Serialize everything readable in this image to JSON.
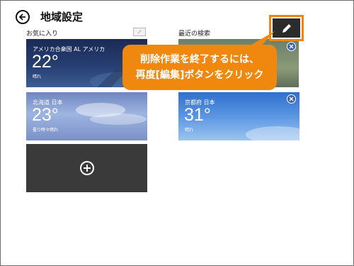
{
  "header": {
    "title": "地域設定"
  },
  "favorites": {
    "section_title": "お気に入り",
    "tiles": [
      {
        "location": "アメリカ合衆国 AL アメリカ",
        "temperature": "22°",
        "condition": "晴れ"
      },
      {
        "location": "北海道 日本",
        "temperature": "23°",
        "condition": "曇り時々晴れ"
      }
    ]
  },
  "recent": {
    "section_title": "最近の検索",
    "tiles": [
      {
        "location": "京都府 日本",
        "temperature": "31°",
        "condition": "晴れ"
      }
    ]
  },
  "callout": {
    "line1": "削除作業を終了するには、",
    "line2": "再度[編集]ボタンをクリック"
  },
  "colors": {
    "accent": "#f0880f",
    "tile_close": "#3b63a8",
    "add_tile": "#3a3a3a"
  },
  "icons": [
    "back-arrow-icon",
    "pencil-icon",
    "close-icon",
    "add-icon"
  ]
}
